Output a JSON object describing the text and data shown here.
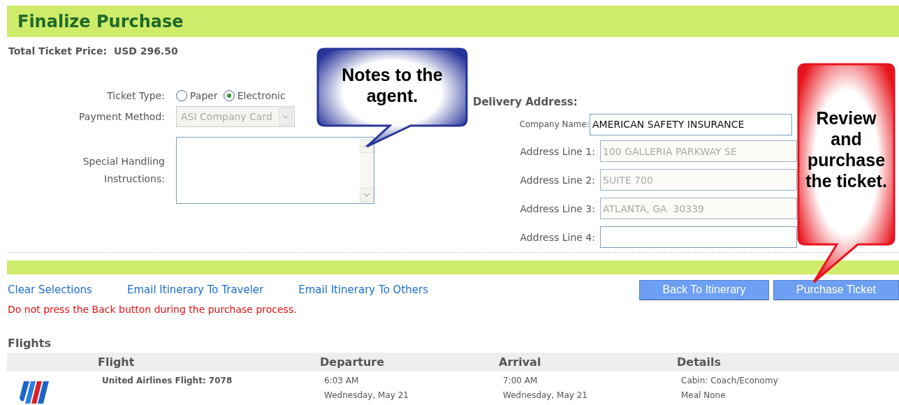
{
  "header": {
    "title": "Finalize Purchase"
  },
  "total_price": {
    "label": "Total Ticket Price:",
    "value": "USD 296.50"
  },
  "ticket_type": {
    "label": "Ticket Type:",
    "options": [
      {
        "label": "Paper",
        "selected": false
      },
      {
        "label": "Electronic",
        "selected": true
      }
    ]
  },
  "payment_method": {
    "label": "Payment Method:",
    "value": "ASI Company Card",
    "disabled": true
  },
  "special_handling": {
    "label": "Special Handling Instructions:"
  },
  "delivery_address": {
    "title": "Delivery Address:",
    "fields": [
      {
        "kind": "small",
        "label": "Company Name:",
        "value": "AMERICAN SAFETY INSURANCE",
        "disabled": false
      },
      {
        "kind": "normal",
        "label": "Address Line 1:",
        "value": "100 GALLERIA PARKWAY SE",
        "disabled": true
      },
      {
        "kind": "normal",
        "label": "Address Line 2:",
        "value": "SUITE 700",
        "disabled": true
      },
      {
        "kind": "normal",
        "label": "Address Line 3:",
        "value": "ATLANTA, GA  30339",
        "disabled": true
      },
      {
        "kind": "normal",
        "label": "Address Line 4:",
        "disabled": false
      }
    ]
  },
  "links": [
    "Clear Selections",
    "Email Itinerary To Traveler",
    "Email Itinerary To Others"
  ],
  "buttons": [
    "Back To Itinerary",
    "Purchase Ticket"
  ],
  "warning": "Do not press the Back button during the purchase process.",
  "flights": {
    "title": "Flights",
    "columns": [
      "Flight",
      "Departure",
      "Arrival",
      "Details"
    ],
    "rows": [
      {
        "flight": "United Airlines Flight: 7078",
        "departure": {
          "time": "6:03 AM",
          "date": "Wednesday, May 21"
        },
        "arrival": {
          "time": "7:00 AM",
          "date": "Wednesday, May 21"
        },
        "details": [
          "Cabin: Coach/Economy",
          "Meal None"
        ]
      }
    ]
  },
  "callouts": [
    {
      "text": "Notes to the agent.",
      "color": "#27349a"
    },
    {
      "text": "Review and purchase the ticket.",
      "color": "#e8141c"
    }
  ]
}
